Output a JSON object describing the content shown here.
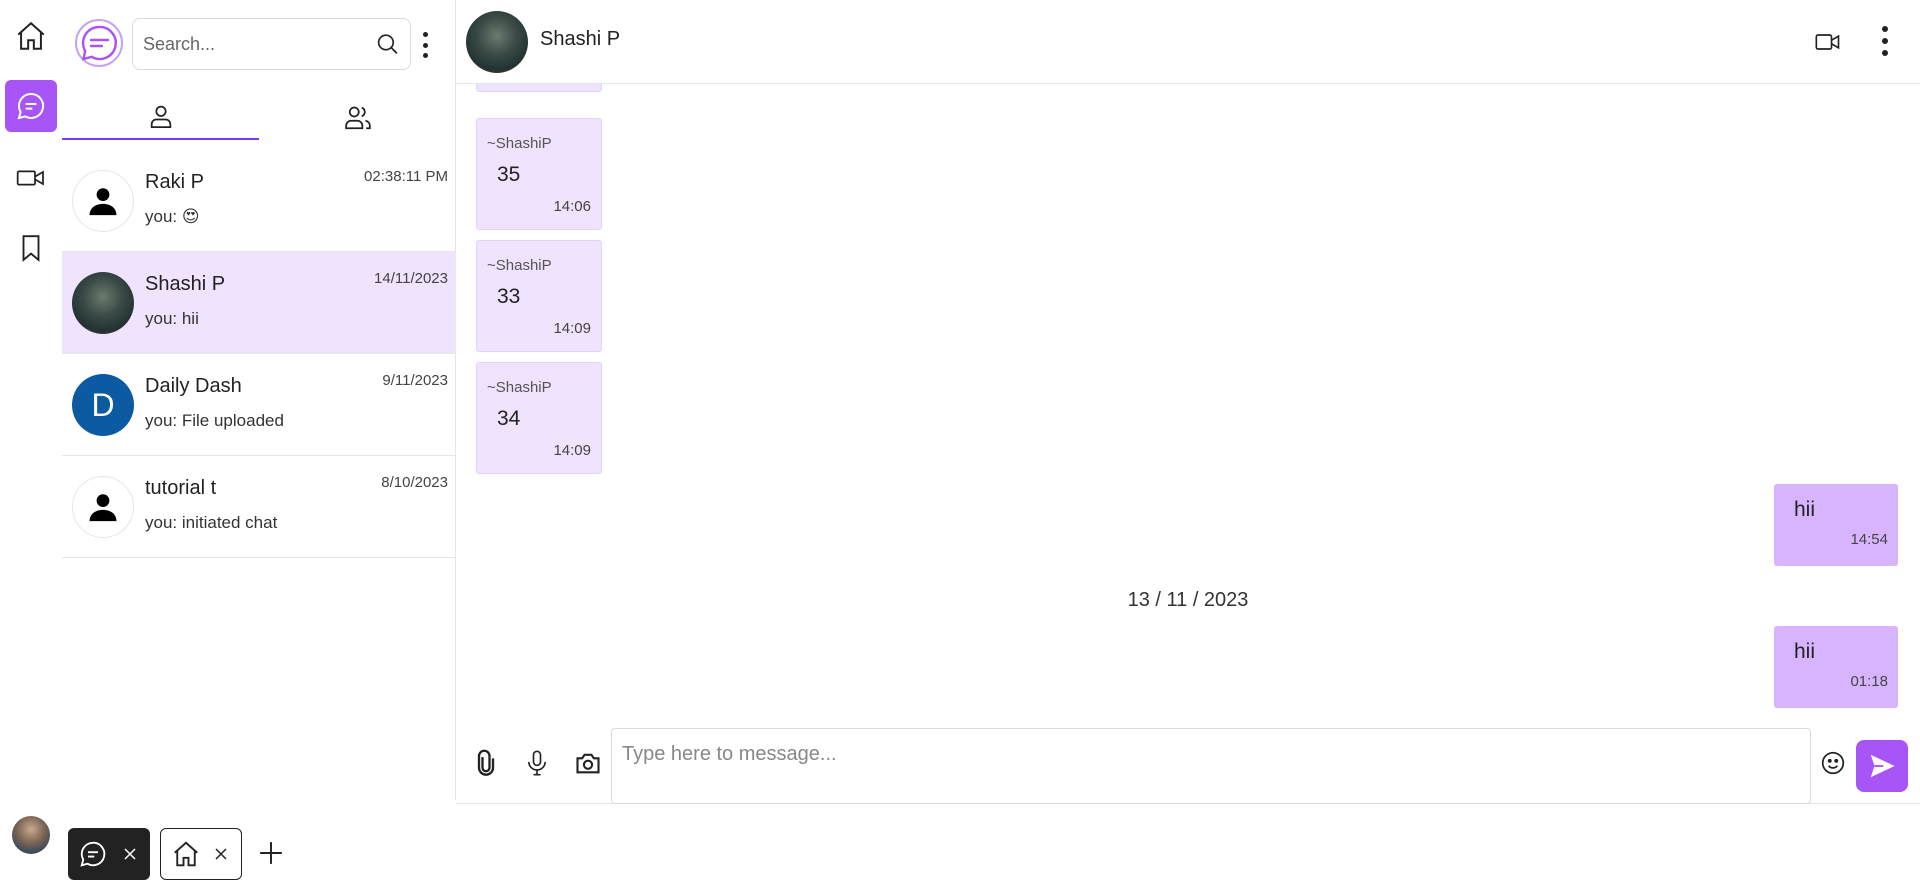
{
  "search": {
    "placeholder": "Search..."
  },
  "chats": [
    {
      "name": "Raki P",
      "preview": "you: 😍",
      "time": "02:38:11 PM",
      "avatar": "person-icon"
    },
    {
      "name": "Shashi P",
      "preview": "you: hii",
      "time": "14/11/2023",
      "avatar": "photo"
    },
    {
      "name": "Daily Dash",
      "preview": "you: File uploaded",
      "time": "9/11/2023",
      "avatar": "D"
    },
    {
      "name": "tutorial t",
      "preview": "you: initiated chat",
      "time": "8/10/2023",
      "avatar": "person-icon"
    }
  ],
  "conversation": {
    "name": "Shashi P",
    "incoming": [
      {
        "sender": "~ShashiP",
        "text": "35",
        "time": "14:06"
      },
      {
        "sender": "~ShashiP",
        "text": "33",
        "time": "14:09"
      },
      {
        "sender": "~ShashiP",
        "text": "34",
        "time": "14:09"
      }
    ],
    "outgoing": [
      {
        "text": "hii",
        "time": "14:54"
      },
      {
        "text": "hii",
        "time": "01:18"
      }
    ],
    "date_separator": "13 / 11 / 2023"
  },
  "composer": {
    "placeholder": "Type here to message..."
  },
  "colors": {
    "accent": "#a855f7",
    "selected_bg": "#efe3fd",
    "outgoing_bubble": "#d8b4fe",
    "tab_underline": "#7e3af2"
  }
}
